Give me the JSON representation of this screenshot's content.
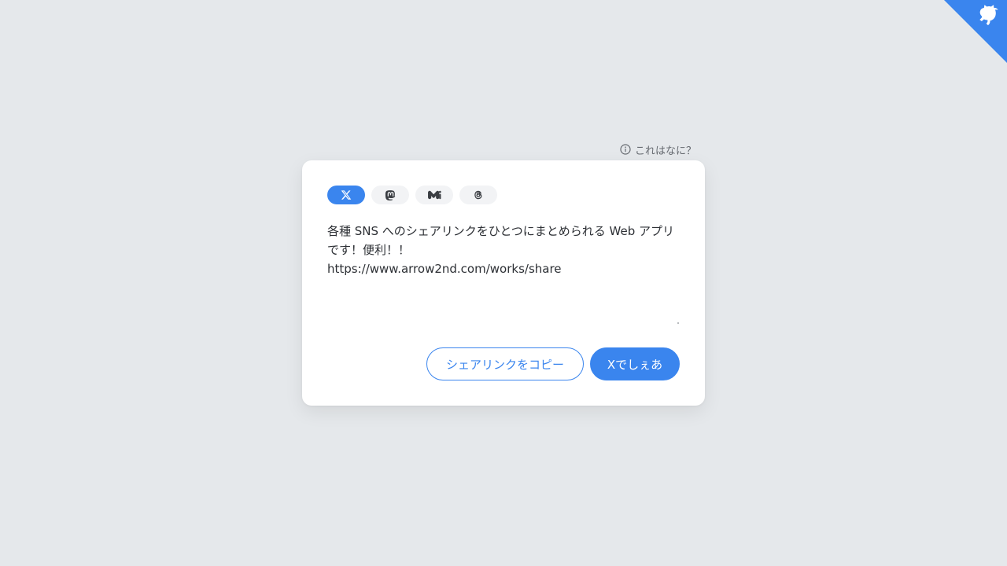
{
  "help": {
    "label": "これはなに？",
    "icon": "info-icon"
  },
  "tabs": [
    {
      "id": "x",
      "icon": "x-logo-icon",
      "active": true
    },
    {
      "id": "mastodon",
      "icon": "mastodon-logo-icon",
      "active": false
    },
    {
      "id": "misskey",
      "icon": "misskey-logo-icon",
      "active": false
    },
    {
      "id": "threads",
      "icon": "threads-logo-icon",
      "active": false
    }
  ],
  "composer": {
    "text": "各種 SNS へのシェアリンクをひとつにまとめられる Web アプリです！便利！！\nhttps://www.arrow2nd.com/works/share"
  },
  "actions": {
    "copy_label": "シェアリンクをコピー",
    "share_label": "Xでしぇあ"
  },
  "corner": {
    "icon": "github-octocat-icon"
  },
  "colors": {
    "accent": "#3a85ee",
    "background": "#e5e8eb",
    "card": "#ffffff"
  }
}
